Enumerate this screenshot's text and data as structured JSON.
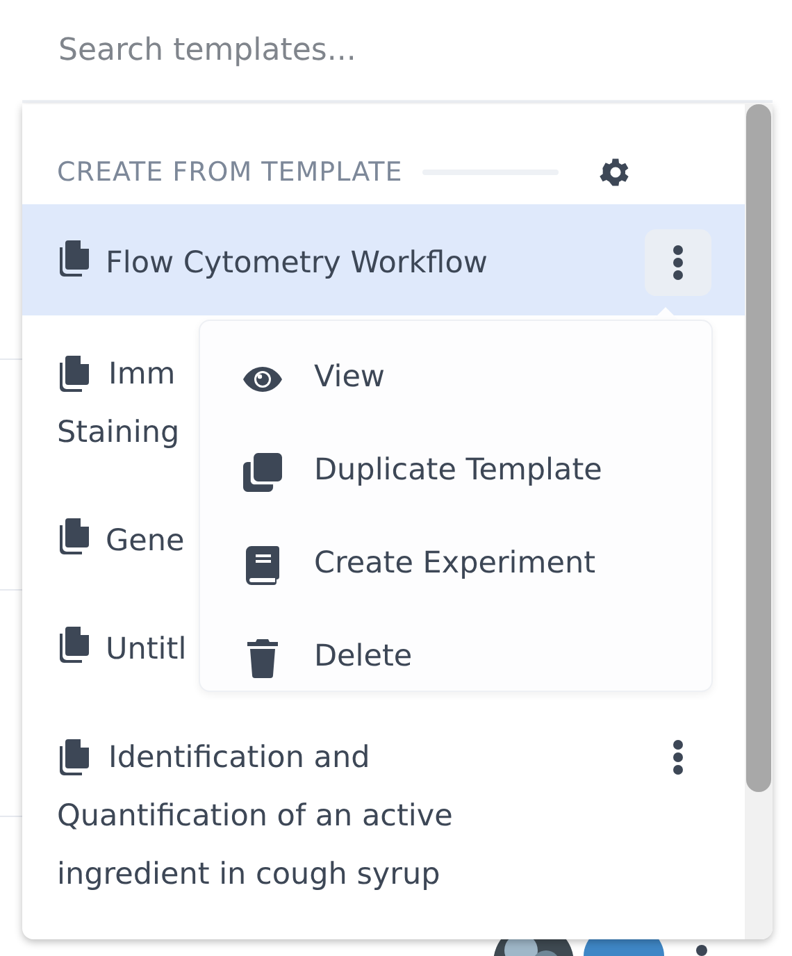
{
  "search": {
    "placeholder": "Search templates..."
  },
  "section": {
    "title": "CREATE FROM TEMPLATE"
  },
  "templates": [
    {
      "lines": [
        "Flow Cytometry Workflow"
      ],
      "selected": true,
      "menu_open": true
    },
    {
      "lines": [
        "Imm",
        "Staining"
      ],
      "selected": false
    },
    {
      "lines": [
        "Gene"
      ],
      "selected": false
    },
    {
      "lines": [
        "Untitl"
      ],
      "selected": false
    },
    {
      "lines": [
        "Identification and",
        "Quantification of an active",
        "ingredient in cough syrup"
      ],
      "selected": false,
      "menu_open": false
    }
  ],
  "menu": [
    {
      "label": "View"
    },
    {
      "label": "Duplicate Template"
    },
    {
      "label": "Create Experiment"
    },
    {
      "label": "Delete"
    }
  ]
}
